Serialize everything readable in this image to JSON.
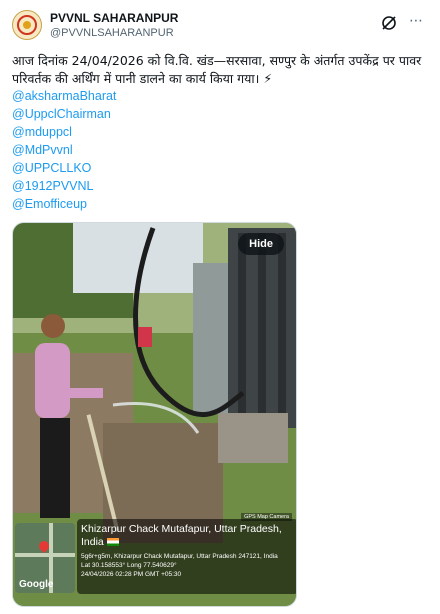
{
  "author": {
    "name": "PVVNL SAHARANPUR",
    "handle": "@PVVNLSAHARANPUR"
  },
  "icons": {
    "grok": "grok-icon",
    "more": "more-options-icon",
    "emoji": "lightning-emoji"
  },
  "tweet": {
    "text": "आज दिनांक 24/04/2026 को वि.वि. खंड—सरसावा, सण्पुर के अंतर्गत उपकेंद्र पर पावर परिवर्तक की अर्थिंग में पानी डालने का कार्य किया गया। ⚡",
    "mentions": [
      "@aksharmaBharat",
      "@UppclChairman",
      "@mduppcl",
      "@MdPvvnl",
      "@UPPCLLKO",
      "@1912PVVNL",
      "@Emofficeup"
    ]
  },
  "media": {
    "hide_label": "Hide",
    "gps_camera_tag": "GPS Map Camera",
    "location_title": "Khizarpur Chack Mutafapur, Uttar Pradesh, India",
    "address": "5g6r+g5m, Khizarpur Chack Mutafapur, Uttar Pradesh 247121, India",
    "coords": "Lat 30.158553° Long 77.540629°",
    "timestamp": "24/04/2026 02:28 PM GMT +05:30",
    "map_brand": "Google"
  },
  "colors": {
    "link": "#1d9bf0",
    "text": "#0f1419",
    "muted": "#536471"
  }
}
